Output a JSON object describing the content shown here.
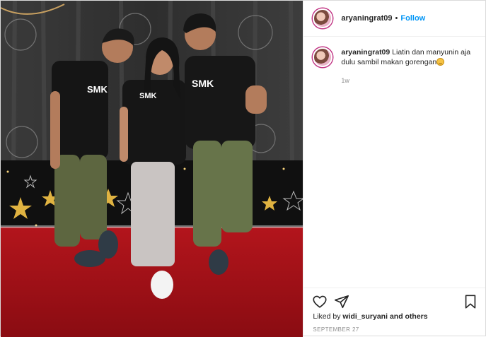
{
  "post": {
    "author": {
      "username": "aryaningrat09",
      "separator": "•",
      "follow_label": "Follow"
    },
    "caption": {
      "username": "aryaningrat09",
      "text": "Liatin dan manyunin aja dulu sambil makan gorengan",
      "emoji": "grimacing-face",
      "age": "1w"
    },
    "icons": {
      "like": "heart-icon",
      "share": "send-icon",
      "save": "bookmark-icon"
    },
    "likes": {
      "prefix": "Liked by",
      "user": "widi_suryani",
      "suffix": "and others"
    },
    "date": "SEPTEMBER 27"
  }
}
